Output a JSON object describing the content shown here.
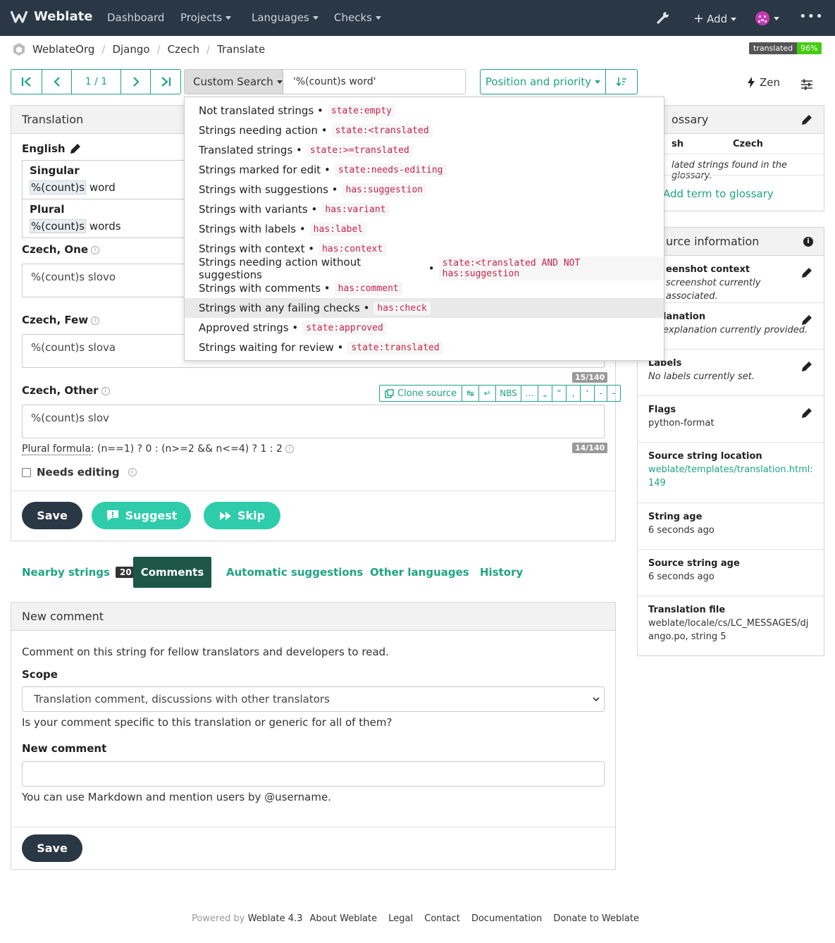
{
  "nav": {
    "brand": "Weblate",
    "items": [
      "Dashboard",
      "Projects",
      "Languages",
      "Checks"
    ],
    "add_label": "Add"
  },
  "breadcrumb": [
    "WeblateOrg",
    "Django",
    "Czech",
    "Translate"
  ],
  "badge": {
    "label": "translated",
    "value": "96%"
  },
  "pager": {
    "position": "1 / 1"
  },
  "search": {
    "type": "Custom Search",
    "query": "'%(count)s word'"
  },
  "sort": {
    "label": "Position and priority"
  },
  "zen_label": "Zen",
  "dropdown": [
    {
      "label": "Not translated strings",
      "query": "state:empty"
    },
    {
      "label": "Strings needing action",
      "query": "state:<translated"
    },
    {
      "label": "Translated strings",
      "query": "state:>=translated"
    },
    {
      "label": "Strings marked for edit",
      "query": "state:needs-editing"
    },
    {
      "label": "Strings with suggestions",
      "query": "has:suggestion"
    },
    {
      "label": "Strings with variants",
      "query": "has:variant"
    },
    {
      "label": "Strings with labels",
      "query": "has:label"
    },
    {
      "label": "Strings with context",
      "query": "has:context"
    },
    {
      "label": "Strings needing action without suggestions",
      "query": "state:<translated AND NOT has:suggestion"
    },
    {
      "label": "Strings with comments",
      "query": "has:comment"
    },
    {
      "label": "Strings with any failing checks",
      "query": "has:check"
    },
    {
      "label": "Approved strings",
      "query": "state:approved"
    },
    {
      "label": "Strings waiting for review",
      "query": "state:translated"
    }
  ],
  "translation": {
    "heading": "Translation",
    "source_lang": "English",
    "singular_label": "Singular",
    "singular_ph": "%(count)s",
    "singular_rest": " word",
    "plural_label": "Plural",
    "plural_ph": "%(count)s",
    "plural_rest": " words",
    "one_label": "Czech, One",
    "one_value": "%(count)s slovo",
    "few_label": "Czech, Few",
    "few_value": "%(count)s slova",
    "few_counter": "15/140",
    "other_label": "Czech, Other",
    "other_value": "%(count)s slov",
    "other_counter": "14/140",
    "clone_label": "Clone source",
    "chars": [
      "↹",
      "↵",
      "NBS",
      "…",
      "„",
      "“",
      "‚",
      "‘",
      "-",
      "–"
    ],
    "formula_label": "Plural formula",
    "formula": ": (n==1) ? 0 : (n>=2 && n<=4) ? 1 : 2",
    "needs_editing": "Needs editing",
    "save": "Save",
    "suggest": "Suggest",
    "skip": "Skip"
  },
  "tabs": {
    "nearby": "Nearby strings",
    "nearby_count": "20",
    "comments": "Comments",
    "auto": "Automatic suggestions",
    "other": "Other languages",
    "history": "History"
  },
  "comment": {
    "heading": "New comment",
    "intro": "Comment on this string for fellow translators and developers to read.",
    "scope_label": "Scope",
    "scope_value": "Translation comment, discussions with other translators",
    "scope_help": "Is your comment specific to this translation or generic for all of them?",
    "new_label": "New comment",
    "markdown_help": "You can use Markdown and mention users by @username.",
    "save": "Save"
  },
  "glossary": {
    "heading": "ossary",
    "col1": "sh",
    "col2": "Czech",
    "empty": "lated strings found in the glossary.",
    "add": "Add term to glossary"
  },
  "source_info": {
    "heading": "urce information",
    "rows": [
      {
        "title": "eenshot context",
        "value": "screenshot currently associated."
      },
      {
        "title": "lanation",
        "value": "explanation currently provided."
      },
      {
        "title": "Labels",
        "value": "No labels currently set."
      },
      {
        "title": "Flags",
        "value": "python-format"
      },
      {
        "title": "Source string location",
        "value": "weblate/templates/translation.html:149"
      },
      {
        "title": "String age",
        "value": "6 seconds ago"
      },
      {
        "title": "Source string age",
        "value": "6 seconds ago"
      },
      {
        "title": "Translation file",
        "value": "weblate/locale/cs/LC_MESSAGES/django.po, string 5"
      }
    ]
  },
  "footer": {
    "powered": "Powered by",
    "version": "Weblate 4.3",
    "links": [
      "About Weblate",
      "Legal",
      "Contact",
      "Documentation",
      "Donate to Weblate"
    ]
  },
  "colors": {
    "navbar": "#2a3744",
    "accent": "#1fa385",
    "dark_button": "#2a3744"
  }
}
